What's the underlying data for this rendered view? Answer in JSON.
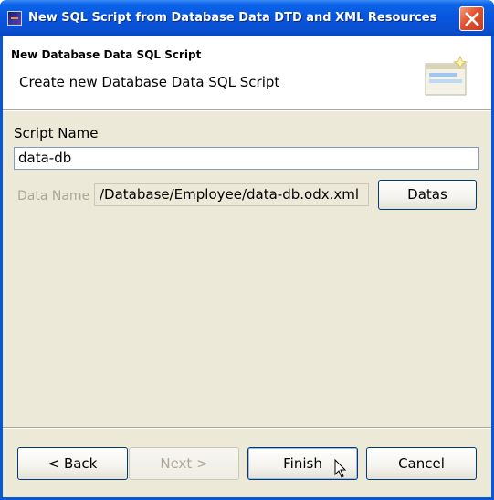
{
  "window": {
    "title": "New SQL Script from Database Data DTD and XML Resources",
    "close_icon": "close-icon"
  },
  "header": {
    "title": "New Database Data SQL Script",
    "description": "Create new Database Data SQL Script",
    "icon": "wizard-banner-icon"
  },
  "form": {
    "script_name_label": "Script Name",
    "script_name_value": "data-db",
    "data_name_label": "Data Name",
    "data_name_value": "/Database/Employee/data-db.odx.xml",
    "datas_button": "Datas"
  },
  "footer": {
    "back_label": "< Back",
    "next_label": "Next >",
    "finish_label": "Finish",
    "cancel_label": "Cancel"
  },
  "colors": {
    "titlebar": "#0855dd",
    "client": "#ece9d8",
    "close": "#e2522f"
  }
}
